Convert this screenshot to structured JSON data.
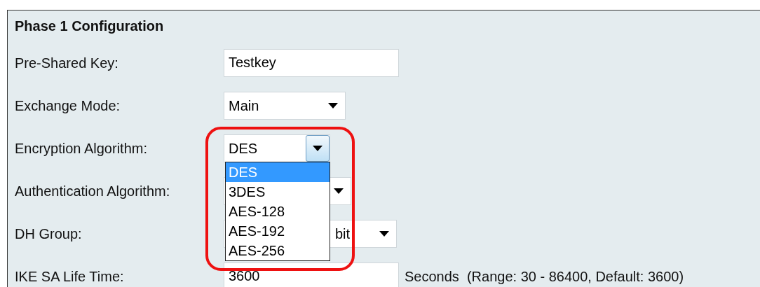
{
  "section": {
    "title": "Phase 1 Configuration",
    "fields": [
      {
        "kind": "text",
        "label": "Pre-Shared Key:",
        "value": "Testkey"
      },
      {
        "kind": "select",
        "label": "Exchange Mode:",
        "value": "Main",
        "expanded": false
      },
      {
        "kind": "select",
        "label": "Encryption Algorithm:",
        "value": "DES",
        "expanded": true,
        "options": [
          {
            "label": "DES",
            "selected": true
          },
          {
            "label": "3DES",
            "selected": false
          },
          {
            "label": "AES-128",
            "selected": false
          },
          {
            "label": "AES-192",
            "selected": false
          },
          {
            "label": "AES-256",
            "selected": false
          }
        ]
      },
      {
        "kind": "select",
        "label": "Authentication Algorithm:",
        "expanded": false
      },
      {
        "kind": "select",
        "label": "DH Group:",
        "value": "bit",
        "expanded": false
      },
      {
        "kind": "text",
        "label": "IKE SA Life Time:",
        "value": "3600",
        "suffix": "Seconds  (Range: 30 - 86400, Default: 3600)"
      }
    ]
  }
}
